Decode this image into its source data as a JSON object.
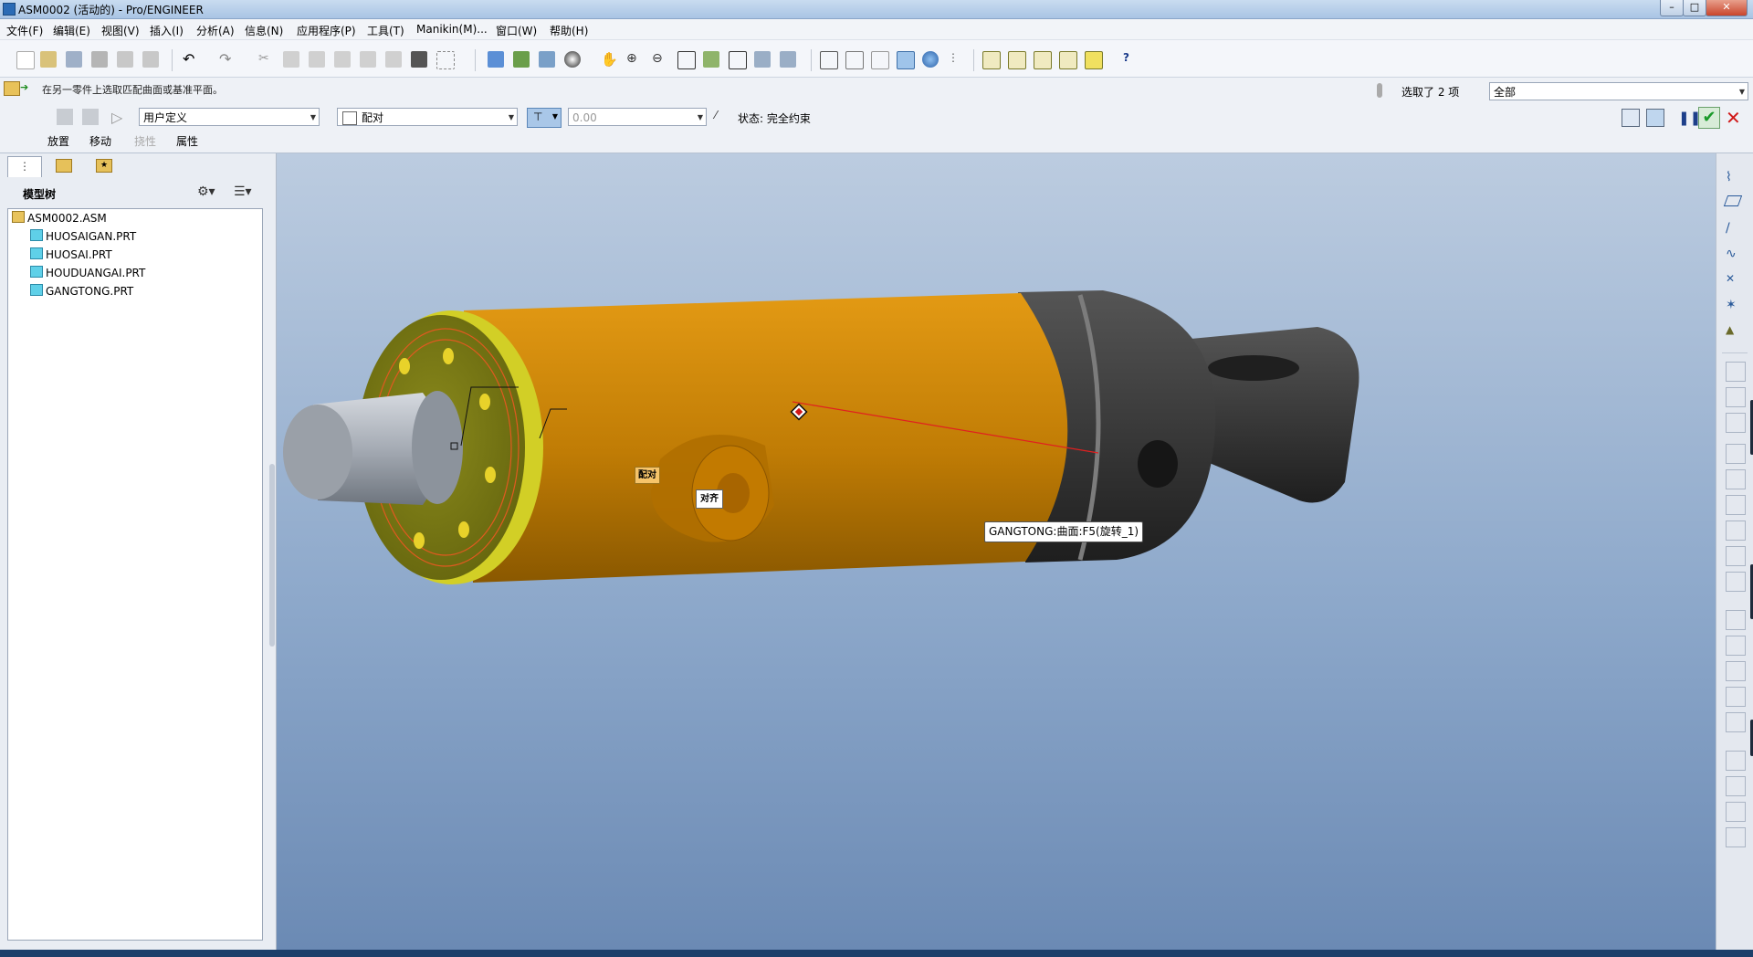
{
  "window": {
    "title": "ASM0002 (活动的) - Pro/ENGINEER",
    "buttons": [
      "minimize",
      "maximize",
      "close"
    ]
  },
  "menu": [
    "文件(F)",
    "编辑(E)",
    "视图(V)",
    "插入(I)",
    "分析(A)",
    "信息(N)",
    "应用程序(P)",
    "工具(T)",
    "Manikin(M)...",
    "窗口(W)",
    "帮助(H)"
  ],
  "prompt": "在另一零件上选取匹配曲面或基准平面。",
  "selection": {
    "status": "选取了 2 项",
    "filter": "全部"
  },
  "dashboard": {
    "set_type": "用户定义",
    "constraint": "配对",
    "offset_value": "0.00",
    "status_label": "状态",
    "status_value": "完全约束",
    "tabs": [
      "放置",
      "移动",
      "挠性",
      "属性"
    ]
  },
  "model_tree": {
    "title": "模型树",
    "root": "ASM0002.ASM",
    "items": [
      "HUOSAIGAN.PRT",
      "HUOSAI.PRT",
      "HOUDUANGAI.PRT",
      "GANGTONG.PRT"
    ]
  },
  "viewport": {
    "tag_mate": "配对",
    "tag_align": "对齐",
    "tooltip": "GANGTONG:曲面:F5(旋转_1)"
  },
  "colors": {
    "cylinder": "#d78a00",
    "flange": "#c8c41a",
    "dark_part": "#3b3b3b",
    "rod": "#a7adb6",
    "accent_check": "#1a9a2a",
    "accent_close": "#d01818"
  }
}
